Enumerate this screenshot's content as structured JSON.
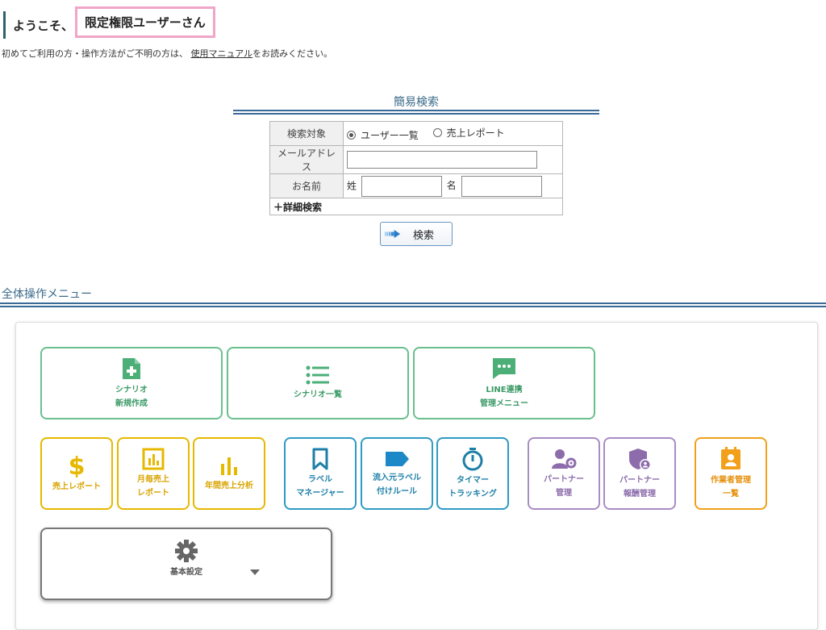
{
  "header": {
    "welcome_prefix": "ようこそ、",
    "user_name": "限定権限ユーザーさん",
    "intro_before": "初めてご利用の方・操作方法がご不明の方は、",
    "intro_link": "使用マニュアル",
    "intro_after": "をお読みください。"
  },
  "quick_search": {
    "title": "簡易検索",
    "target_label": "検索対象",
    "options": [
      "ユーザー一覧",
      "売上レポート"
    ],
    "selected_option": "ユーザー一覧",
    "email_label": "メールアドレス",
    "email_value": "",
    "name_label": "お名前",
    "last_name_label": "姓",
    "first_name_label": "名",
    "last_name_value": "",
    "first_name_value": "",
    "advanced_label": "＋詳細検索",
    "search_button": "検索"
  },
  "menu": {
    "title": "全体操作メニュー",
    "tiles": [
      {
        "line1": "シナリオ",
        "line2": "新規作成",
        "icon": "file-plus-icon"
      },
      {
        "line1": "シナリオ一覧",
        "line2": "",
        "icon": "list-icon"
      },
      {
        "line1": "LINE連携",
        "line2": "管理メニュー",
        "icon": "chat-icon"
      },
      {
        "line1": "売上レポート",
        "line2": "",
        "icon": "dollar-icon"
      },
      {
        "line1": "月毎売上",
        "line2": "レポート",
        "icon": "bar-chart-box-icon"
      },
      {
        "line1": "年間売上分析",
        "line2": "",
        "icon": "bar-chart-icon"
      },
      {
        "line1": "ラベル",
        "line2": "マネージャー",
        "icon": "bookmark-icon"
      },
      {
        "line1": "流入元ラベル",
        "line2": "付けルール",
        "icon": "label-tag-icon"
      },
      {
        "line1": "タイマー",
        "line2": "トラッキング",
        "icon": "stopwatch-icon"
      },
      {
        "line1": "パートナー",
        "line2": "管理",
        "icon": "user-gear-icon"
      },
      {
        "line1": "パートナー",
        "line2": "報酬管理",
        "icon": "shield-user-icon"
      },
      {
        "line1": "作業者管理",
        "line2": "一覧",
        "icon": "contact-card-icon"
      },
      {
        "line1": "基本設定",
        "line2": "",
        "icon": "gear-icon"
      }
    ]
  },
  "colors": {
    "green": "#6abf8e",
    "yellow": "#e6b800",
    "blue": "#2f9ac4",
    "purple": "#a98cc4",
    "orange": "#f2a01a",
    "gray": "#777777",
    "pink_highlight": "#f0a6c8"
  }
}
